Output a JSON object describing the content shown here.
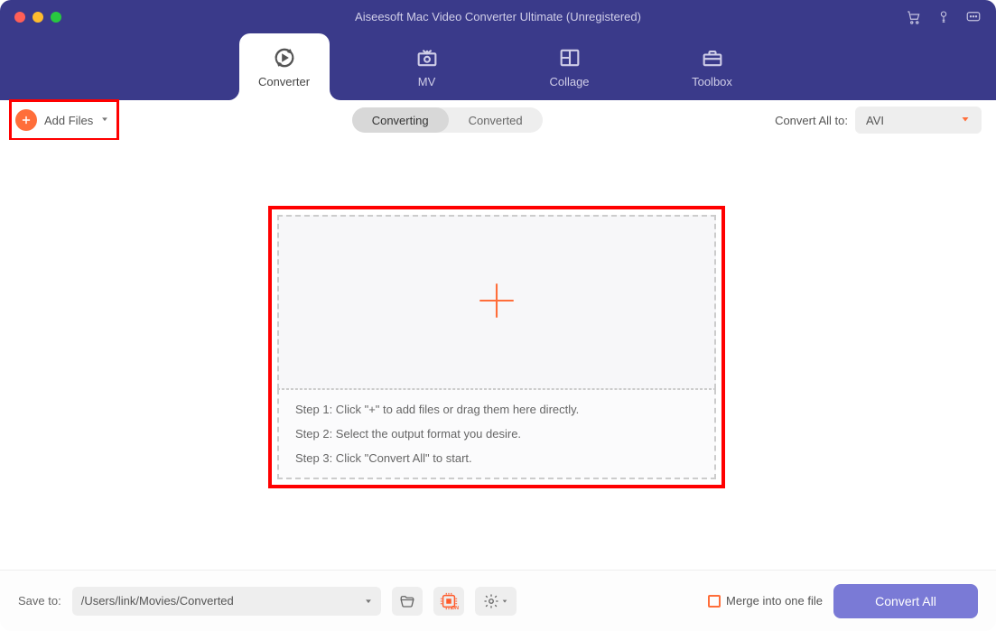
{
  "app": {
    "title": "Aiseesoft Mac Video Converter Ultimate (Unregistered)"
  },
  "nav": {
    "converter": "Converter",
    "mv": "MV",
    "collage": "Collage",
    "toolbox": "Toolbox"
  },
  "toolbar": {
    "add_files": "Add Files",
    "tab_converting": "Converting",
    "tab_converted": "Converted",
    "convert_all_to": "Convert All to:",
    "format": "AVI"
  },
  "dropzone": {
    "step1": "Step 1: Click \"+\" to add files or drag them here directly.",
    "step2": "Step 2: Select the output format you desire.",
    "step3": "Step 3: Click \"Convert All\" to start."
  },
  "footer": {
    "save_to_label": "Save to:",
    "path": "/Users/link/Movies/Converted",
    "merge_label": "Merge into one file",
    "convert_all": "Convert All"
  }
}
